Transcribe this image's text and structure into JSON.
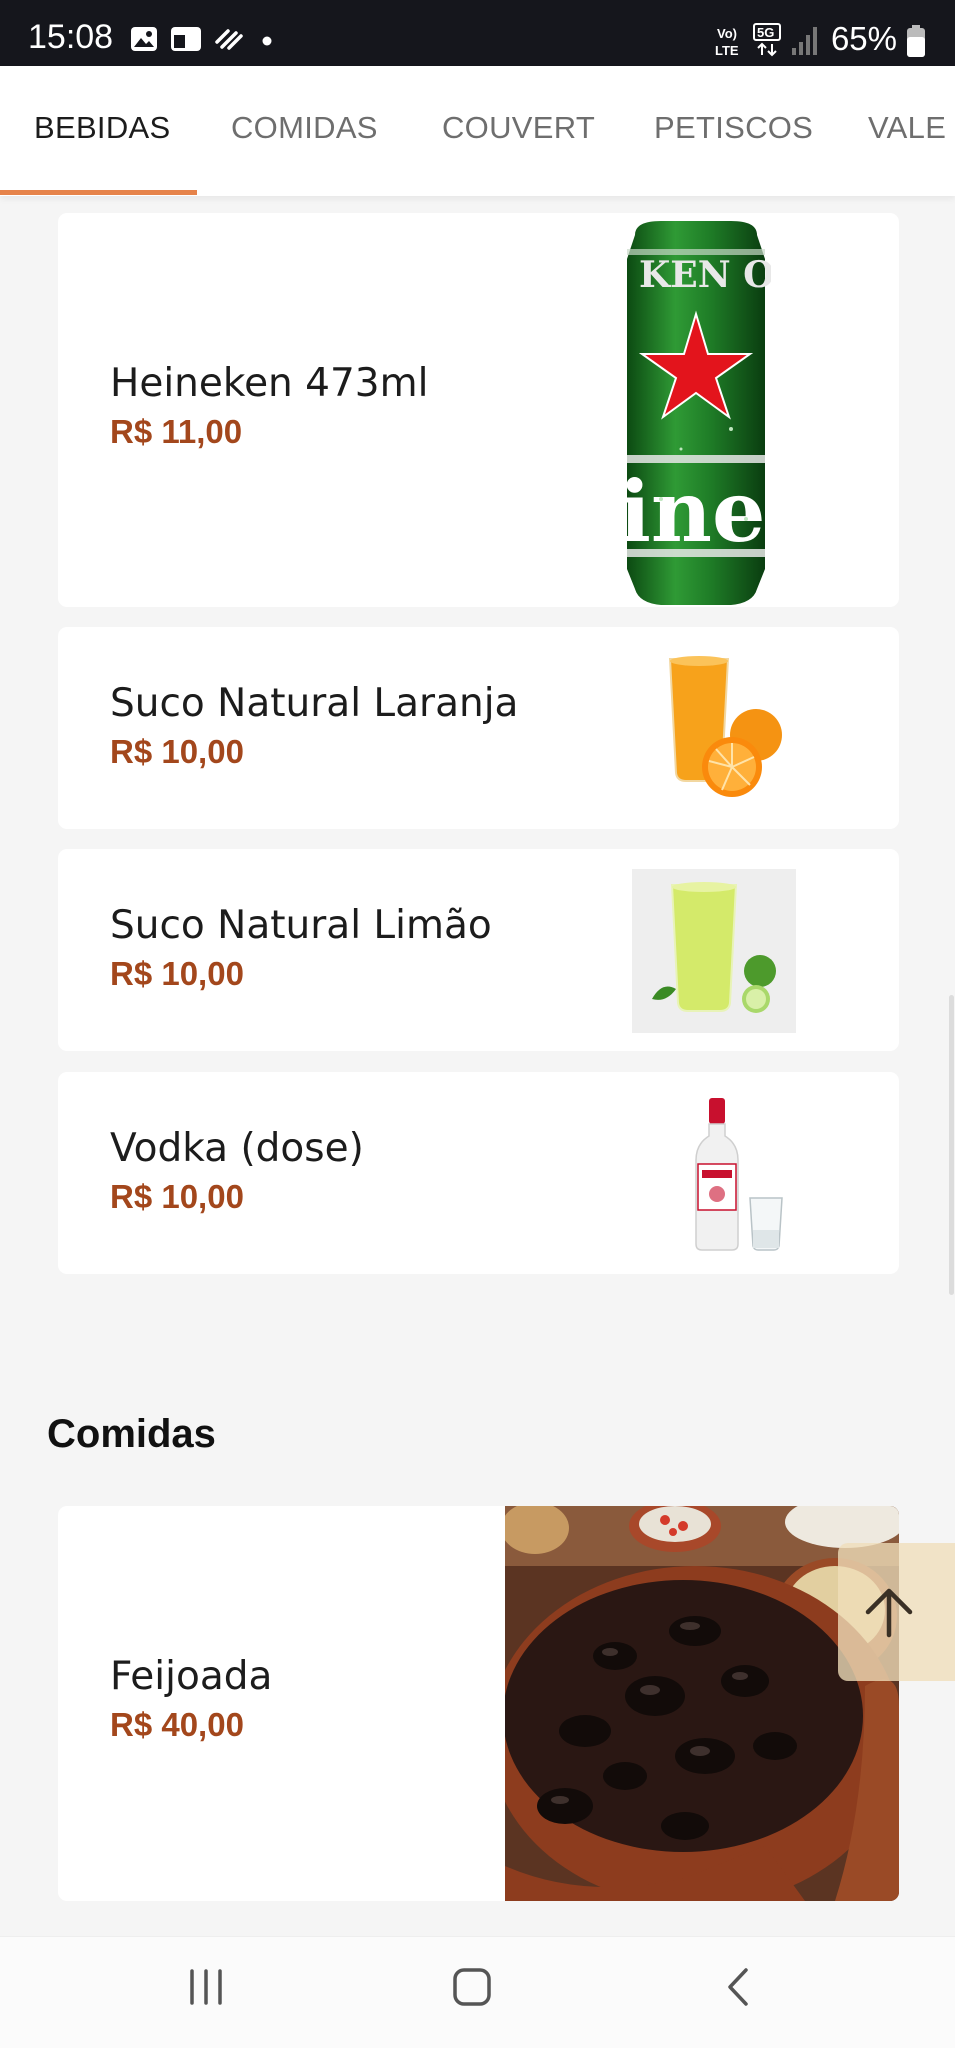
{
  "status_bar": {
    "time": "15:08",
    "battery": "65%",
    "icons": [
      "gallery-icon",
      "calendar-icon",
      "sync-icon",
      "dot-icon",
      "volte-icon",
      "5g-icon",
      "signal-icon",
      "battery-icon"
    ]
  },
  "tabs": [
    {
      "label": "BEBIDAS",
      "active": true
    },
    {
      "label": "COMIDAS",
      "active": false
    },
    {
      "label": "COUVERT",
      "active": false
    },
    {
      "label": "PETISCOS",
      "active": false
    },
    {
      "label": "VALE",
      "active": false
    }
  ],
  "bebidas": [
    {
      "name": "Heineken 473ml",
      "price": "R$ 11,00",
      "image": "heineken-can"
    },
    {
      "name": "Suco Natural Laranja",
      "price": "R$ 10,00",
      "image": "orange-juice"
    },
    {
      "name": "Suco Natural Limão",
      "price": "R$ 10,00",
      "image": "lime-juice"
    },
    {
      "name": "Vodka (dose)",
      "price": "R$ 10,00",
      "image": "vodka-bottle-and-shot"
    }
  ],
  "comidas": {
    "title": "Comidas",
    "items": [
      {
        "name": "Feijoada",
        "price": "R$ 40,00",
        "image": "feijoada-pot"
      }
    ]
  },
  "scroll_top_icon": "arrow-up-icon",
  "nav_icons": [
    "recent-apps-icon",
    "home-icon",
    "back-icon"
  ],
  "colors": {
    "accent": "#e6834a",
    "price": "#a3471c",
    "status_bar": "#15161c"
  }
}
